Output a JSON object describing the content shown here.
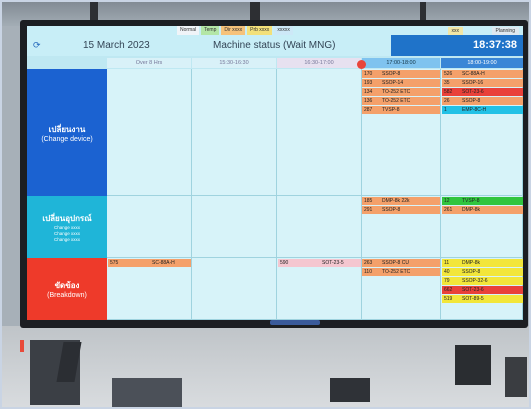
{
  "screen": {
    "tabs": [
      {
        "label": "Normal",
        "color": "#f0f4f8"
      },
      {
        "label": "Temp",
        "color": "#b3e6a6"
      },
      {
        "label": "Dir xxxx",
        "color": "#f6c27a"
      },
      {
        "label": "Prb xxxx",
        "color": "#f2e07a"
      },
      {
        "label": "xxxxx",
        "color": "#cde8f7"
      }
    ],
    "date": "15 March 2023",
    "title": "Machine status (Wait MNG)",
    "clock": "18:37:38",
    "buttons": [
      "xxx",
      "Planning"
    ],
    "columns": [
      "Over 8 Hrs",
      "15:30-16:30",
      "16:30-17:00",
      "17:00-18:00",
      "18:00-19:00"
    ],
    "rows": [
      {
        "main": "เปลี่ยนงาน",
        "sub": "(Change device)",
        "color": "#1b62d1"
      },
      {
        "main": "เปลี่ยนอุปกรณ์",
        "sub_lines": [
          "Change xxxx",
          "Change xxxx",
          "Change xxxx"
        ],
        "color": "#1fb5d8"
      },
      {
        "main": "ขัดข้อง",
        "sub": "(Breakdown)",
        "color": "#ee3a2a"
      }
    ],
    "col4": {
      "row1": [
        {
          "num": "170",
          "text": "SSOP-8",
          "color": "#f4a06a"
        },
        {
          "num": "193",
          "text": "SSOP-14",
          "color": "#f4a06a"
        },
        {
          "num": "134",
          "text": "TO-252 ETC",
          "color": "#f4a06a"
        },
        {
          "num": "136",
          "text": "TO-252 ETC",
          "color": "#f4a06a"
        },
        {
          "num": "287",
          "text": "TVSP-8",
          "color": "#f4a06a"
        }
      ],
      "row2": [
        {
          "num": "185",
          "text": "DMP-8k 22k",
          "color": "#f4a06a"
        },
        {
          "num": "291",
          "text": "SSOP-8",
          "color": "#f4a06a"
        }
      ],
      "row3": [
        {
          "num": "263",
          "text": "SSOP-8 CU",
          "color": "#f4a06a"
        },
        {
          "num": "110",
          "text": "TO-252 ETC",
          "color": "#f4a06a"
        }
      ]
    },
    "col5": {
      "row1": [
        {
          "num": "526",
          "text": "SC-88A-H",
          "color": "#f4a06a"
        },
        {
          "num": "35",
          "text": "SSOP-16",
          "color": "#f4a06a"
        },
        {
          "num": "582",
          "text": "SOT-23-6",
          "color": "#e9413a"
        },
        {
          "num": "26",
          "text": "SSOP-8",
          "color": "#f4a06a"
        },
        {
          "num": "1",
          "text": "EMP-8C-H",
          "color": "#23c1e6"
        }
      ],
      "row2": [
        {
          "num": "12",
          "text": "TVSP-8",
          "color": "#31c53e"
        },
        {
          "num": "261",
          "text": "DMP-8k",
          "color": "#f4a06a"
        }
      ],
      "row3": [
        {
          "num": "11",
          "text": "DMP-8k",
          "color": "#f2e63a"
        },
        {
          "num": "40",
          "text": "SSOP-8",
          "color": "#f2e63a"
        },
        {
          "num": "79",
          "text": "SSOP-32-6",
          "color": "#f2e63a"
        },
        {
          "num": "662",
          "text": "SOT-23-6",
          "color": "#e9413a"
        },
        {
          "num": "519",
          "text": "SOT-89-5",
          "color": "#f2e63a"
        }
      ]
    },
    "col1_breakdown": {
      "num": "575",
      "text": "SC-88A-H",
      "color": "#f4a06a"
    },
    "col3_breakdown": {
      "num": "590",
      "text": "SOT-23-5",
      "color": "#f4c6d0"
    }
  }
}
